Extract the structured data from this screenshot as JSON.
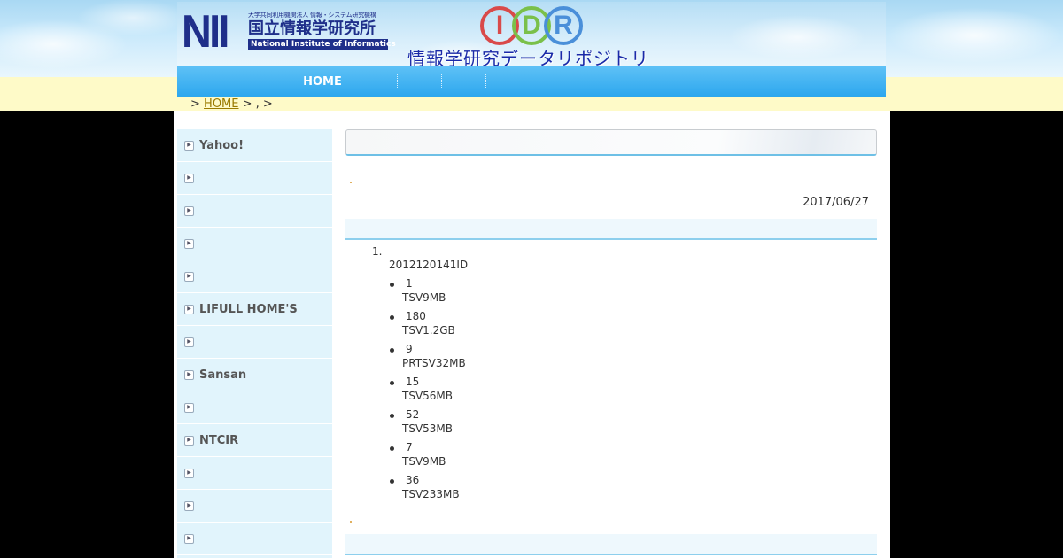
{
  "header": {
    "nii_mark": "NII",
    "nii_small": "大学共同利用機関法人 情報・システム研究機構",
    "nii_name_jp": "国立情報学研究所",
    "nii_name_en": "National Institute of Informatics",
    "idr_letters": [
      "I",
      "D",
      "R"
    ],
    "site_title": "情報学研究データリポジトリ"
  },
  "nav": {
    "home_label": "HOME"
  },
  "breadcrumb": {
    "prefix": ">",
    "home_link": "HOME",
    "rest": "> , >"
  },
  "sidebar": {
    "items": [
      {
        "label": "Yahoo!"
      },
      {
        "label": ""
      },
      {
        "label": ""
      },
      {
        "label": ""
      },
      {
        "label": ""
      },
      {
        "label": "LIFULL HOME'S"
      },
      {
        "label": ""
      },
      {
        "label": "Sansan"
      },
      {
        "label": ""
      },
      {
        "label": "NTCIR"
      },
      {
        "label": ""
      },
      {
        "label": ""
      },
      {
        "label": ""
      }
    ]
  },
  "main": {
    "title": "",
    "date": "2017/06/27",
    "list": {
      "number": "1.",
      "text": "2012120141ID",
      "bullets": [
        {
          "count": "1",
          "desc": "TSV9MB"
        },
        {
          "count": "180",
          "desc": "TSV1.2GB"
        },
        {
          "count": "9",
          "desc": "PRTSV32MB"
        },
        {
          "count": "15",
          "desc": "TSV56MB"
        },
        {
          "count": "52",
          "desc": "TSV53MB"
        },
        {
          "count": "7",
          "desc": "TSV9MB"
        },
        {
          "count": "36",
          "desc": "TSV233MB"
        }
      ]
    }
  },
  "colors": {
    "nav_bg": "#2ba6ee",
    "sidebar_bg": "#e1f4fc",
    "accent_line": "#8dcfed",
    "link": "#9a7a00",
    "title_blue": "#1a2aa8"
  }
}
